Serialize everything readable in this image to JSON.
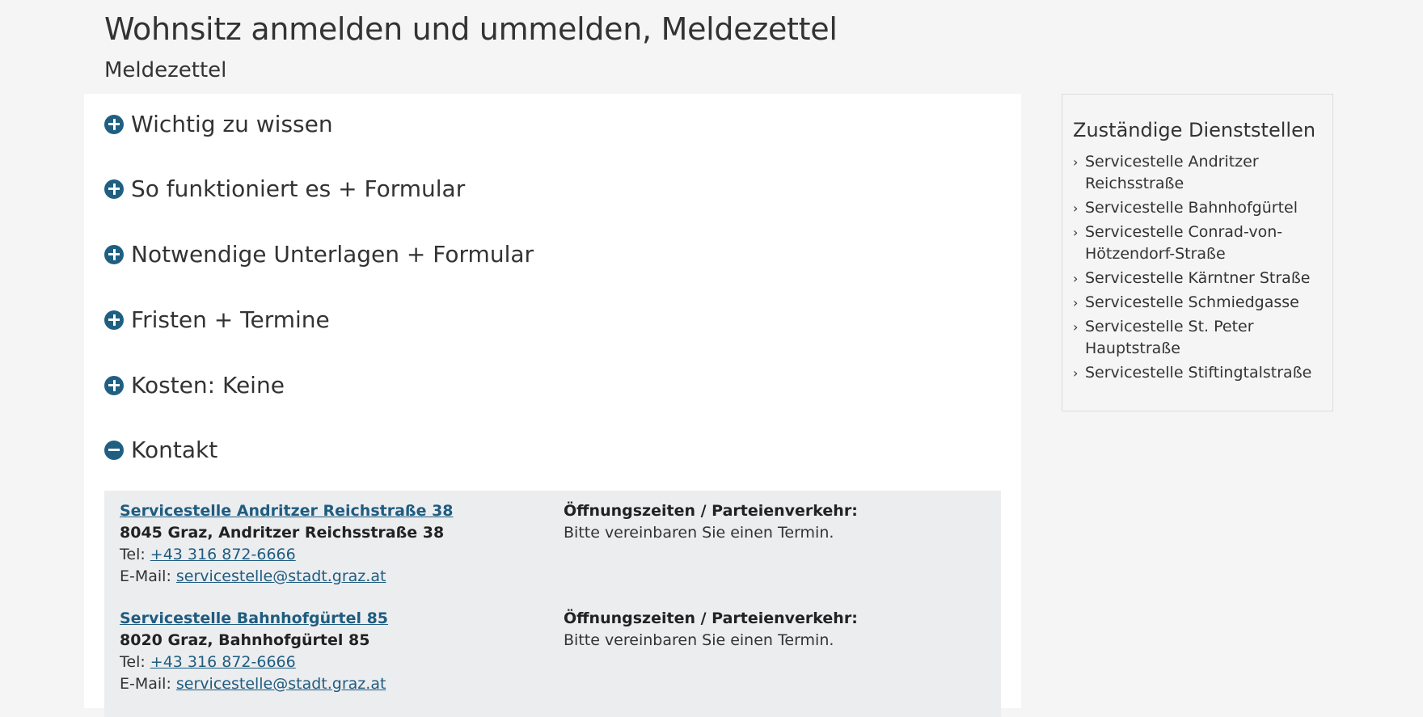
{
  "page": {
    "title": "Wohnsitz anmelden und ummelden, Meldezettel",
    "subtitle": "Meldezettel"
  },
  "accordion": [
    {
      "label": "Wichtig zu wissen",
      "state": "collapsed",
      "icon": "plus-circle-icon"
    },
    {
      "label": "So funktioniert es + Formular",
      "state": "collapsed",
      "icon": "plus-circle-icon"
    },
    {
      "label": "Notwendige Unterlagen + Formular",
      "state": "collapsed",
      "icon": "plus-circle-icon"
    },
    {
      "label": "Fristen + Termine",
      "state": "collapsed",
      "icon": "plus-circle-icon"
    },
    {
      "label": "Kosten: Keine",
      "state": "collapsed",
      "icon": "plus-circle-icon"
    },
    {
      "label": "Kontakt",
      "state": "expanded",
      "icon": "minus-circle-icon"
    }
  ],
  "contacts": [
    {
      "name": "Servicestelle Andritzer Reichstraße 38",
      "address": "8045 Graz, Andritzer Reichsstraße 38",
      "tel_label": "Tel: ",
      "tel": "+43 316 872-6666",
      "email_label": "E-Mail: ",
      "email": "servicestelle@stadt.graz.at",
      "hours_heading": "Öffnungszeiten / Parteienverkehr:",
      "hours_text": "Bitte vereinbaren Sie einen Termin."
    },
    {
      "name": "Servicestelle Bahnhofgürtel 85",
      "address": "8020 Graz, Bahnhofgürtel 85",
      "tel_label": "Tel: ",
      "tel": "+43 316 872-6666",
      "email_label": "E-Mail: ",
      "email": "servicestelle@stadt.graz.at",
      "hours_heading": "Öffnungszeiten / Parteienverkehr:",
      "hours_text": "Bitte vereinbaren Sie einen Termin."
    }
  ],
  "sidebar": {
    "title": "Zuständige Dienststellen",
    "items": [
      {
        "label": "Servicestelle Andritzer Reichsstraße"
      },
      {
        "label": "Servicestelle Bahnhofgürtel"
      },
      {
        "label": "Servicestelle Conrad-von-Hötzendorf-Straße"
      },
      {
        "label": "Servicestelle Kärntner Straße"
      },
      {
        "label": "Servicestelle Schmiedgasse"
      },
      {
        "label": "Servicestelle St. Peter Hauptstraße"
      },
      {
        "label": "Servicestelle Stiftingtalstraße"
      }
    ]
  },
  "colors": {
    "accent": "#1f6082",
    "link": "#1f5c80",
    "page_bg": "#f5f5f5",
    "panel_bg": "#ecedef"
  }
}
